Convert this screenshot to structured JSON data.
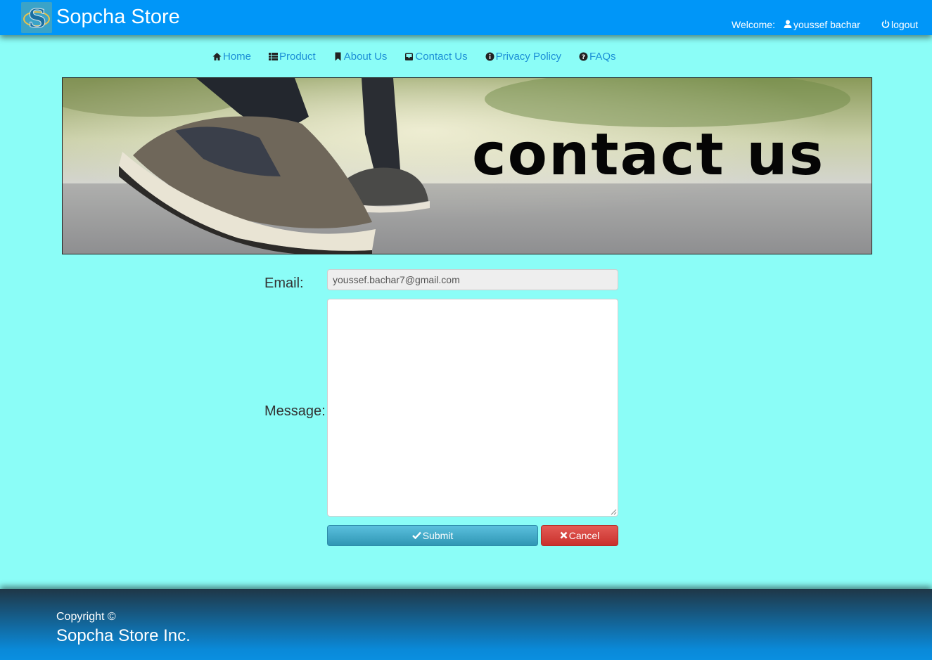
{
  "header": {
    "brand": "Sopcha Store",
    "welcome_label": "Welcome:",
    "username": "youssef bachar",
    "logout_label": "logout"
  },
  "nav": {
    "home": "Home",
    "product": "Product",
    "about": "About Us",
    "contact": "Contact Us",
    "privacy": "Privacy Policy",
    "faqs": "FAQs"
  },
  "banner": {
    "heading": "contact us"
  },
  "form": {
    "email_label": "Email:",
    "email_value": "youssef.bachar7@gmail.com",
    "message_label": "Message:",
    "message_value": "",
    "submit_label": "Submit",
    "cancel_label": "Cancel"
  },
  "footer": {
    "copyright": "Copyright ©",
    "company": "Sopcha Store Inc."
  },
  "colors": {
    "header_bg": "#0096f8",
    "page_bg": "#8bfdf7",
    "link": "#1c8fd6",
    "submit": "#3fb1d0",
    "cancel": "#d9534f"
  }
}
